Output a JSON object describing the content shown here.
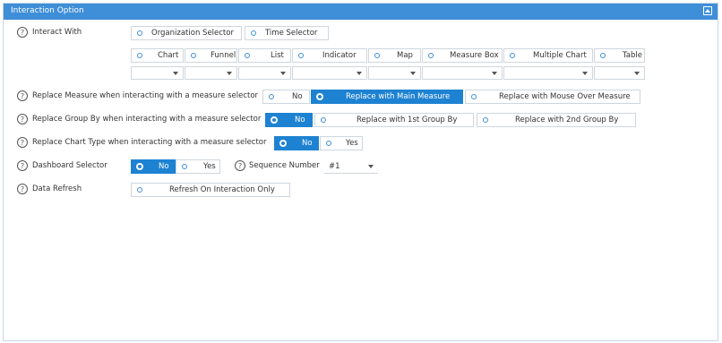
{
  "panel": {
    "title": "Interaction Option",
    "collapse_icon": "collapse-up-icon"
  },
  "interact_with": {
    "label": "Interact With",
    "selectors": [
      "Organization Selector",
      "Time Selector"
    ],
    "widgets": [
      "Chart",
      "Funnel",
      "List",
      "Indicator",
      "Map",
      "Measure Box",
      "Multiple Chart",
      "Table"
    ]
  },
  "replace_measure": {
    "label": "Replace Measure when interacting with a measure selector",
    "options": [
      "No",
      "Replace with Main Measure",
      "Replace with Mouse Over Measure"
    ],
    "selected": "Replace with Main Measure"
  },
  "replace_group": {
    "label": "Replace Group By when interacting with a measure selector",
    "options": [
      "No",
      "Replace with 1st Group By",
      "Replace with 2nd Group By"
    ],
    "selected": "No"
  },
  "replace_chart_type": {
    "label": "Replace Chart Type when interacting with a measure selector",
    "options": [
      "No",
      "Yes"
    ],
    "selected": "No"
  },
  "dashboard_selector": {
    "label": "Dashboard Selector",
    "options": [
      "No",
      "Yes"
    ],
    "selected": "No",
    "sequence_label": "Sequence Number",
    "sequence_value": "#1"
  },
  "data_refresh": {
    "label": "Data Refresh",
    "options": [
      "Refresh On Interaction Only"
    ]
  },
  "colors": {
    "header": "#3e8ed8",
    "selected": "#1e82d2",
    "border": "#cfd6dd"
  }
}
